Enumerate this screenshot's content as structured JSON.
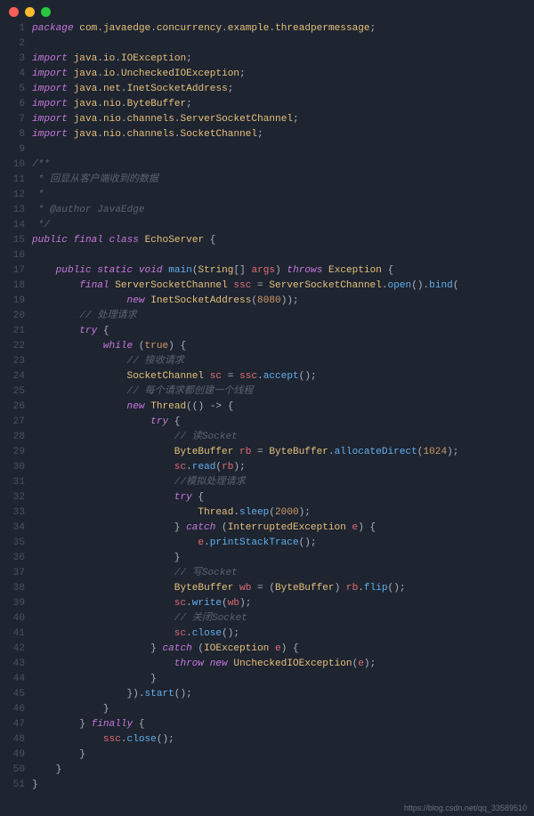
{
  "footer": "https://blog.csdn.net/qq_33589510",
  "lines": [
    {
      "n": 1,
      "tokens": [
        {
          "c": "kw",
          "t": "package"
        },
        {
          "c": "pun",
          "t": " "
        },
        {
          "c": "pkg",
          "t": "com"
        },
        {
          "c": "pun",
          "t": "."
        },
        {
          "c": "pkg",
          "t": "javaedge"
        },
        {
          "c": "pun",
          "t": "."
        },
        {
          "c": "pkg",
          "t": "concurrency"
        },
        {
          "c": "pun",
          "t": "."
        },
        {
          "c": "pkg",
          "t": "example"
        },
        {
          "c": "pun",
          "t": "."
        },
        {
          "c": "pkg",
          "t": "threadpermessage"
        },
        {
          "c": "pun",
          "t": ";"
        }
      ]
    },
    {
      "n": 2,
      "tokens": []
    },
    {
      "n": 3,
      "tokens": [
        {
          "c": "kw",
          "t": "import"
        },
        {
          "c": "pun",
          "t": " "
        },
        {
          "c": "pkg",
          "t": "java"
        },
        {
          "c": "pun",
          "t": "."
        },
        {
          "c": "pkg",
          "t": "io"
        },
        {
          "c": "pun",
          "t": "."
        },
        {
          "c": "pkg",
          "t": "IOException"
        },
        {
          "c": "pun",
          "t": ";"
        }
      ]
    },
    {
      "n": 4,
      "tokens": [
        {
          "c": "kw",
          "t": "import"
        },
        {
          "c": "pun",
          "t": " "
        },
        {
          "c": "pkg",
          "t": "java"
        },
        {
          "c": "pun",
          "t": "."
        },
        {
          "c": "pkg",
          "t": "io"
        },
        {
          "c": "pun",
          "t": "."
        },
        {
          "c": "pkg",
          "t": "UncheckedIOException"
        },
        {
          "c": "pun",
          "t": ";"
        }
      ]
    },
    {
      "n": 5,
      "tokens": [
        {
          "c": "kw",
          "t": "import"
        },
        {
          "c": "pun",
          "t": " "
        },
        {
          "c": "pkg",
          "t": "java"
        },
        {
          "c": "pun",
          "t": "."
        },
        {
          "c": "pkg",
          "t": "net"
        },
        {
          "c": "pun",
          "t": "."
        },
        {
          "c": "pkg",
          "t": "InetSocketAddress"
        },
        {
          "c": "pun",
          "t": ";"
        }
      ]
    },
    {
      "n": 6,
      "tokens": [
        {
          "c": "kw",
          "t": "import"
        },
        {
          "c": "pun",
          "t": " "
        },
        {
          "c": "pkg",
          "t": "java"
        },
        {
          "c": "pun",
          "t": "."
        },
        {
          "c": "pkg",
          "t": "nio"
        },
        {
          "c": "pun",
          "t": "."
        },
        {
          "c": "pkg",
          "t": "ByteBuffer"
        },
        {
          "c": "pun",
          "t": ";"
        }
      ]
    },
    {
      "n": 7,
      "tokens": [
        {
          "c": "kw",
          "t": "import"
        },
        {
          "c": "pun",
          "t": " "
        },
        {
          "c": "pkg",
          "t": "java"
        },
        {
          "c": "pun",
          "t": "."
        },
        {
          "c": "pkg",
          "t": "nio"
        },
        {
          "c": "pun",
          "t": "."
        },
        {
          "c": "pkg",
          "t": "channels"
        },
        {
          "c": "pun",
          "t": "."
        },
        {
          "c": "pkg",
          "t": "ServerSocketChannel"
        },
        {
          "c": "pun",
          "t": ";"
        }
      ]
    },
    {
      "n": 8,
      "tokens": [
        {
          "c": "kw",
          "t": "import"
        },
        {
          "c": "pun",
          "t": " "
        },
        {
          "c": "pkg",
          "t": "java"
        },
        {
          "c": "pun",
          "t": "."
        },
        {
          "c": "pkg",
          "t": "nio"
        },
        {
          "c": "pun",
          "t": "."
        },
        {
          "c": "pkg",
          "t": "channels"
        },
        {
          "c": "pun",
          "t": "."
        },
        {
          "c": "pkg",
          "t": "SocketChannel"
        },
        {
          "c": "pun",
          "t": ";"
        }
      ]
    },
    {
      "n": 9,
      "tokens": []
    },
    {
      "n": 10,
      "tokens": [
        {
          "c": "cmt",
          "t": "/**"
        }
      ]
    },
    {
      "n": 11,
      "tokens": [
        {
          "c": "cmt",
          "t": " * 回显从客户端收到的数据"
        }
      ]
    },
    {
      "n": 12,
      "tokens": [
        {
          "c": "cmt",
          "t": " *"
        }
      ]
    },
    {
      "n": 13,
      "tokens": [
        {
          "c": "cmt",
          "t": " * @author JavaEdge"
        }
      ]
    },
    {
      "n": 14,
      "tokens": [
        {
          "c": "cmt",
          "t": " */"
        }
      ]
    },
    {
      "n": 15,
      "tokens": [
        {
          "c": "kw",
          "t": "public"
        },
        {
          "c": "pun",
          "t": " "
        },
        {
          "c": "kw",
          "t": "final"
        },
        {
          "c": "pun",
          "t": " "
        },
        {
          "c": "kw",
          "t": "class"
        },
        {
          "c": "pun",
          "t": " "
        },
        {
          "c": "pkg",
          "t": "EchoServer"
        },
        {
          "c": "pun",
          "t": " {"
        }
      ]
    },
    {
      "n": 16,
      "tokens": []
    },
    {
      "n": 17,
      "tokens": [
        {
          "c": "pun",
          "t": "    "
        },
        {
          "c": "kw",
          "t": "public"
        },
        {
          "c": "pun",
          "t": " "
        },
        {
          "c": "kw",
          "t": "static"
        },
        {
          "c": "pun",
          "t": " "
        },
        {
          "c": "kw",
          "t": "void"
        },
        {
          "c": "pun",
          "t": " "
        },
        {
          "c": "mth",
          "t": "main"
        },
        {
          "c": "pun",
          "t": "("
        },
        {
          "c": "pkg",
          "t": "String"
        },
        {
          "c": "pun",
          "t": "[] "
        },
        {
          "c": "var",
          "t": "args"
        },
        {
          "c": "pun",
          "t": ") "
        },
        {
          "c": "kw",
          "t": "throws"
        },
        {
          "c": "pun",
          "t": " "
        },
        {
          "c": "pkg",
          "t": "Exception"
        },
        {
          "c": "pun",
          "t": " {"
        }
      ]
    },
    {
      "n": 18,
      "tokens": [
        {
          "c": "pun",
          "t": "        "
        },
        {
          "c": "kw",
          "t": "final"
        },
        {
          "c": "pun",
          "t": " "
        },
        {
          "c": "pkg",
          "t": "ServerSocketChannel"
        },
        {
          "c": "pun",
          "t": " "
        },
        {
          "c": "var",
          "t": "ssc"
        },
        {
          "c": "pun",
          "t": " = "
        },
        {
          "c": "pkg",
          "t": "ServerSocketChannel"
        },
        {
          "c": "pun",
          "t": "."
        },
        {
          "c": "mth",
          "t": "open"
        },
        {
          "c": "pun",
          "t": "()."
        },
        {
          "c": "mth",
          "t": "bind"
        },
        {
          "c": "pun",
          "t": "("
        }
      ]
    },
    {
      "n": 19,
      "tokens": [
        {
          "c": "pun",
          "t": "                "
        },
        {
          "c": "kw",
          "t": "new"
        },
        {
          "c": "pun",
          "t": " "
        },
        {
          "c": "pkg",
          "t": "InetSocketAddress"
        },
        {
          "c": "pun",
          "t": "("
        },
        {
          "c": "num",
          "t": "8080"
        },
        {
          "c": "pun",
          "t": "));"
        }
      ]
    },
    {
      "n": 20,
      "tokens": [
        {
          "c": "pun",
          "t": "        "
        },
        {
          "c": "cmt",
          "t": "// 处理请求"
        }
      ]
    },
    {
      "n": 21,
      "tokens": [
        {
          "c": "pun",
          "t": "        "
        },
        {
          "c": "kw",
          "t": "try"
        },
        {
          "c": "pun",
          "t": " {"
        }
      ]
    },
    {
      "n": 22,
      "tokens": [
        {
          "c": "pun",
          "t": "            "
        },
        {
          "c": "kw",
          "t": "while"
        },
        {
          "c": "pun",
          "t": " ("
        },
        {
          "c": "bool",
          "t": "true"
        },
        {
          "c": "pun",
          "t": ") {"
        }
      ]
    },
    {
      "n": 23,
      "tokens": [
        {
          "c": "pun",
          "t": "                "
        },
        {
          "c": "cmt",
          "t": "// 接收请求"
        }
      ]
    },
    {
      "n": 24,
      "tokens": [
        {
          "c": "pun",
          "t": "                "
        },
        {
          "c": "pkg",
          "t": "SocketChannel"
        },
        {
          "c": "pun",
          "t": " "
        },
        {
          "c": "var",
          "t": "sc"
        },
        {
          "c": "pun",
          "t": " = "
        },
        {
          "c": "var",
          "t": "ssc"
        },
        {
          "c": "pun",
          "t": "."
        },
        {
          "c": "mth",
          "t": "accept"
        },
        {
          "c": "pun",
          "t": "();"
        }
      ]
    },
    {
      "n": 25,
      "tokens": [
        {
          "c": "pun",
          "t": "                "
        },
        {
          "c": "cmt",
          "t": "// 每个请求都创建一个线程"
        }
      ]
    },
    {
      "n": 26,
      "tokens": [
        {
          "c": "pun",
          "t": "                "
        },
        {
          "c": "kw",
          "t": "new"
        },
        {
          "c": "pun",
          "t": " "
        },
        {
          "c": "pkg",
          "t": "Thread"
        },
        {
          "c": "pun",
          "t": "(() -> {"
        }
      ]
    },
    {
      "n": 27,
      "tokens": [
        {
          "c": "pun",
          "t": "                    "
        },
        {
          "c": "kw",
          "t": "try"
        },
        {
          "c": "pun",
          "t": " {"
        }
      ]
    },
    {
      "n": 28,
      "tokens": [
        {
          "c": "pun",
          "t": "                        "
        },
        {
          "c": "cmt",
          "t": "// 读Socket"
        }
      ]
    },
    {
      "n": 29,
      "tokens": [
        {
          "c": "pun",
          "t": "                        "
        },
        {
          "c": "pkg",
          "t": "ByteBuffer"
        },
        {
          "c": "pun",
          "t": " "
        },
        {
          "c": "var",
          "t": "rb"
        },
        {
          "c": "pun",
          "t": " = "
        },
        {
          "c": "pkg",
          "t": "ByteBuffer"
        },
        {
          "c": "pun",
          "t": "."
        },
        {
          "c": "mth",
          "t": "allocateDirect"
        },
        {
          "c": "pun",
          "t": "("
        },
        {
          "c": "num",
          "t": "1024"
        },
        {
          "c": "pun",
          "t": ");"
        }
      ]
    },
    {
      "n": 30,
      "tokens": [
        {
          "c": "pun",
          "t": "                        "
        },
        {
          "c": "var",
          "t": "sc"
        },
        {
          "c": "pun",
          "t": "."
        },
        {
          "c": "mth",
          "t": "read"
        },
        {
          "c": "pun",
          "t": "("
        },
        {
          "c": "var",
          "t": "rb"
        },
        {
          "c": "pun",
          "t": ");"
        }
      ]
    },
    {
      "n": 31,
      "tokens": [
        {
          "c": "pun",
          "t": "                        "
        },
        {
          "c": "cmt",
          "t": "//模拟处理请求"
        }
      ]
    },
    {
      "n": 32,
      "tokens": [
        {
          "c": "pun",
          "t": "                        "
        },
        {
          "c": "kw",
          "t": "try"
        },
        {
          "c": "pun",
          "t": " {"
        }
      ]
    },
    {
      "n": 33,
      "tokens": [
        {
          "c": "pun",
          "t": "                            "
        },
        {
          "c": "pkg",
          "t": "Thread"
        },
        {
          "c": "pun",
          "t": "."
        },
        {
          "c": "mth",
          "t": "sleep"
        },
        {
          "c": "pun",
          "t": "("
        },
        {
          "c": "num",
          "t": "2000"
        },
        {
          "c": "pun",
          "t": ");"
        }
      ]
    },
    {
      "n": 34,
      "tokens": [
        {
          "c": "pun",
          "t": "                        } "
        },
        {
          "c": "kw",
          "t": "catch"
        },
        {
          "c": "pun",
          "t": " ("
        },
        {
          "c": "pkg",
          "t": "InterruptedException"
        },
        {
          "c": "pun",
          "t": " "
        },
        {
          "c": "var",
          "t": "e"
        },
        {
          "c": "pun",
          "t": ") {"
        }
      ]
    },
    {
      "n": 35,
      "tokens": [
        {
          "c": "pun",
          "t": "                            "
        },
        {
          "c": "var",
          "t": "e"
        },
        {
          "c": "pun",
          "t": "."
        },
        {
          "c": "mth",
          "t": "printStackTrace"
        },
        {
          "c": "pun",
          "t": "();"
        }
      ]
    },
    {
      "n": 36,
      "tokens": [
        {
          "c": "pun",
          "t": "                        }"
        }
      ]
    },
    {
      "n": 37,
      "tokens": [
        {
          "c": "pun",
          "t": "                        "
        },
        {
          "c": "cmt",
          "t": "// 写Socket"
        }
      ]
    },
    {
      "n": 38,
      "tokens": [
        {
          "c": "pun",
          "t": "                        "
        },
        {
          "c": "pkg",
          "t": "ByteBuffer"
        },
        {
          "c": "pun",
          "t": " "
        },
        {
          "c": "var",
          "t": "wb"
        },
        {
          "c": "pun",
          "t": " = ("
        },
        {
          "c": "pkg",
          "t": "ByteBuffer"
        },
        {
          "c": "pun",
          "t": ") "
        },
        {
          "c": "var",
          "t": "rb"
        },
        {
          "c": "pun",
          "t": "."
        },
        {
          "c": "mth",
          "t": "flip"
        },
        {
          "c": "pun",
          "t": "();"
        }
      ]
    },
    {
      "n": 39,
      "tokens": [
        {
          "c": "pun",
          "t": "                        "
        },
        {
          "c": "var",
          "t": "sc"
        },
        {
          "c": "pun",
          "t": "."
        },
        {
          "c": "mth",
          "t": "write"
        },
        {
          "c": "pun",
          "t": "("
        },
        {
          "c": "var",
          "t": "wb"
        },
        {
          "c": "pun",
          "t": ");"
        }
      ]
    },
    {
      "n": 40,
      "tokens": [
        {
          "c": "pun",
          "t": "                        "
        },
        {
          "c": "cmt",
          "t": "// 关闭Socket"
        }
      ]
    },
    {
      "n": 41,
      "tokens": [
        {
          "c": "pun",
          "t": "                        "
        },
        {
          "c": "var",
          "t": "sc"
        },
        {
          "c": "pun",
          "t": "."
        },
        {
          "c": "mth",
          "t": "close"
        },
        {
          "c": "pun",
          "t": "();"
        }
      ]
    },
    {
      "n": 42,
      "tokens": [
        {
          "c": "pun",
          "t": "                    } "
        },
        {
          "c": "kw",
          "t": "catch"
        },
        {
          "c": "pun",
          "t": " ("
        },
        {
          "c": "pkg",
          "t": "IOException"
        },
        {
          "c": "pun",
          "t": " "
        },
        {
          "c": "var",
          "t": "e"
        },
        {
          "c": "pun",
          "t": ") {"
        }
      ]
    },
    {
      "n": 43,
      "tokens": [
        {
          "c": "pun",
          "t": "                        "
        },
        {
          "c": "kw",
          "t": "throw"
        },
        {
          "c": "pun",
          "t": " "
        },
        {
          "c": "kw",
          "t": "new"
        },
        {
          "c": "pun",
          "t": " "
        },
        {
          "c": "pkg",
          "t": "UncheckedIOException"
        },
        {
          "c": "pun",
          "t": "("
        },
        {
          "c": "var",
          "t": "e"
        },
        {
          "c": "pun",
          "t": ");"
        }
      ]
    },
    {
      "n": 44,
      "tokens": [
        {
          "c": "pun",
          "t": "                    }"
        }
      ]
    },
    {
      "n": 45,
      "tokens": [
        {
          "c": "pun",
          "t": "                })."
        },
        {
          "c": "mth",
          "t": "start"
        },
        {
          "c": "pun",
          "t": "();"
        }
      ]
    },
    {
      "n": 46,
      "tokens": [
        {
          "c": "pun",
          "t": "            }"
        }
      ]
    },
    {
      "n": 47,
      "tokens": [
        {
          "c": "pun",
          "t": "        } "
        },
        {
          "c": "kw",
          "t": "finally"
        },
        {
          "c": "pun",
          "t": " {"
        }
      ]
    },
    {
      "n": 48,
      "tokens": [
        {
          "c": "pun",
          "t": "            "
        },
        {
          "c": "var",
          "t": "ssc"
        },
        {
          "c": "pun",
          "t": "."
        },
        {
          "c": "mth",
          "t": "close"
        },
        {
          "c": "pun",
          "t": "();"
        }
      ]
    },
    {
      "n": 49,
      "tokens": [
        {
          "c": "pun",
          "t": "        }"
        }
      ]
    },
    {
      "n": 50,
      "tokens": [
        {
          "c": "pun",
          "t": "    }"
        }
      ]
    },
    {
      "n": 51,
      "tokens": [
        {
          "c": "pun",
          "t": "}"
        }
      ]
    }
  ]
}
